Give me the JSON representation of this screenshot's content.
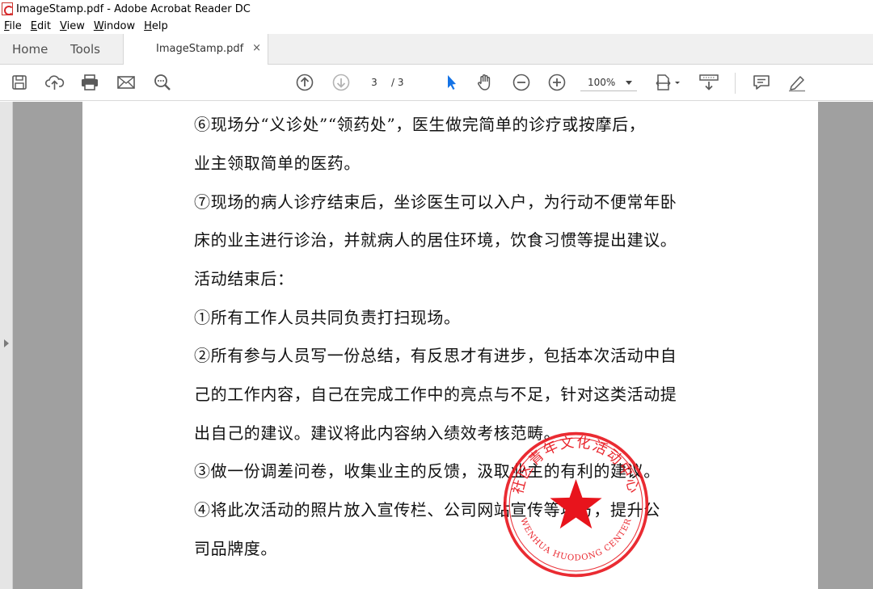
{
  "window": {
    "title": "ImageStamp.pdf - Adobe Acrobat Reader DC"
  },
  "menu": [
    {
      "accel": "F",
      "rest": "ile"
    },
    {
      "accel": "E",
      "rest": "dit"
    },
    {
      "accel": "V",
      "rest": "iew"
    },
    {
      "accel": "W",
      "rest": "indow"
    },
    {
      "accel": "H",
      "rest": "elp"
    }
  ],
  "tabs": {
    "home": "Home",
    "tools": "Tools",
    "document": "ImageStamp.pdf",
    "close": "×"
  },
  "toolbar": {
    "page_current": "3",
    "page_total": "/ 3",
    "zoom": "100%"
  },
  "colors": {
    "accent_blue": "#1473e6",
    "stamp_red": "#e8141c",
    "viewer_gray": "#a0a0a0"
  },
  "document": {
    "lines": [
      "⑥现场分“义诊处”“领药处”，医生做完简单的诊疗或按摩后，",
      "业主领取简单的医药。",
      "⑦现场的病人诊疗结束后，坐诊医生可以入户，为行动不便常年卧",
      "床的业主进行诊治，并就病人的居住环境，饮食习惯等提出建议。",
      "活动结束后：",
      "①所有工作人员共同负责打扫现场。",
      "②所有参与人员写一份总结，有反思才有进步，包括本次活动中自",
      "己的工作内容，自己在完成工作中的亮点与不足，针对这类活动提",
      "出自己的建议。建议将此内容纳入绩效考核范畴。",
      "③做一份调差问卷，收集业主的反馈，汲取业主的有利的建议。",
      "④将此次活动的照片放入宣传栏、公司网站宣传等地方，提升公",
      "司品牌度。"
    ]
  },
  "stamp": {
    "top_text": "社区青年文化活动中心",
    "bottom_text": "WENHUA HUODONG CENTER"
  }
}
